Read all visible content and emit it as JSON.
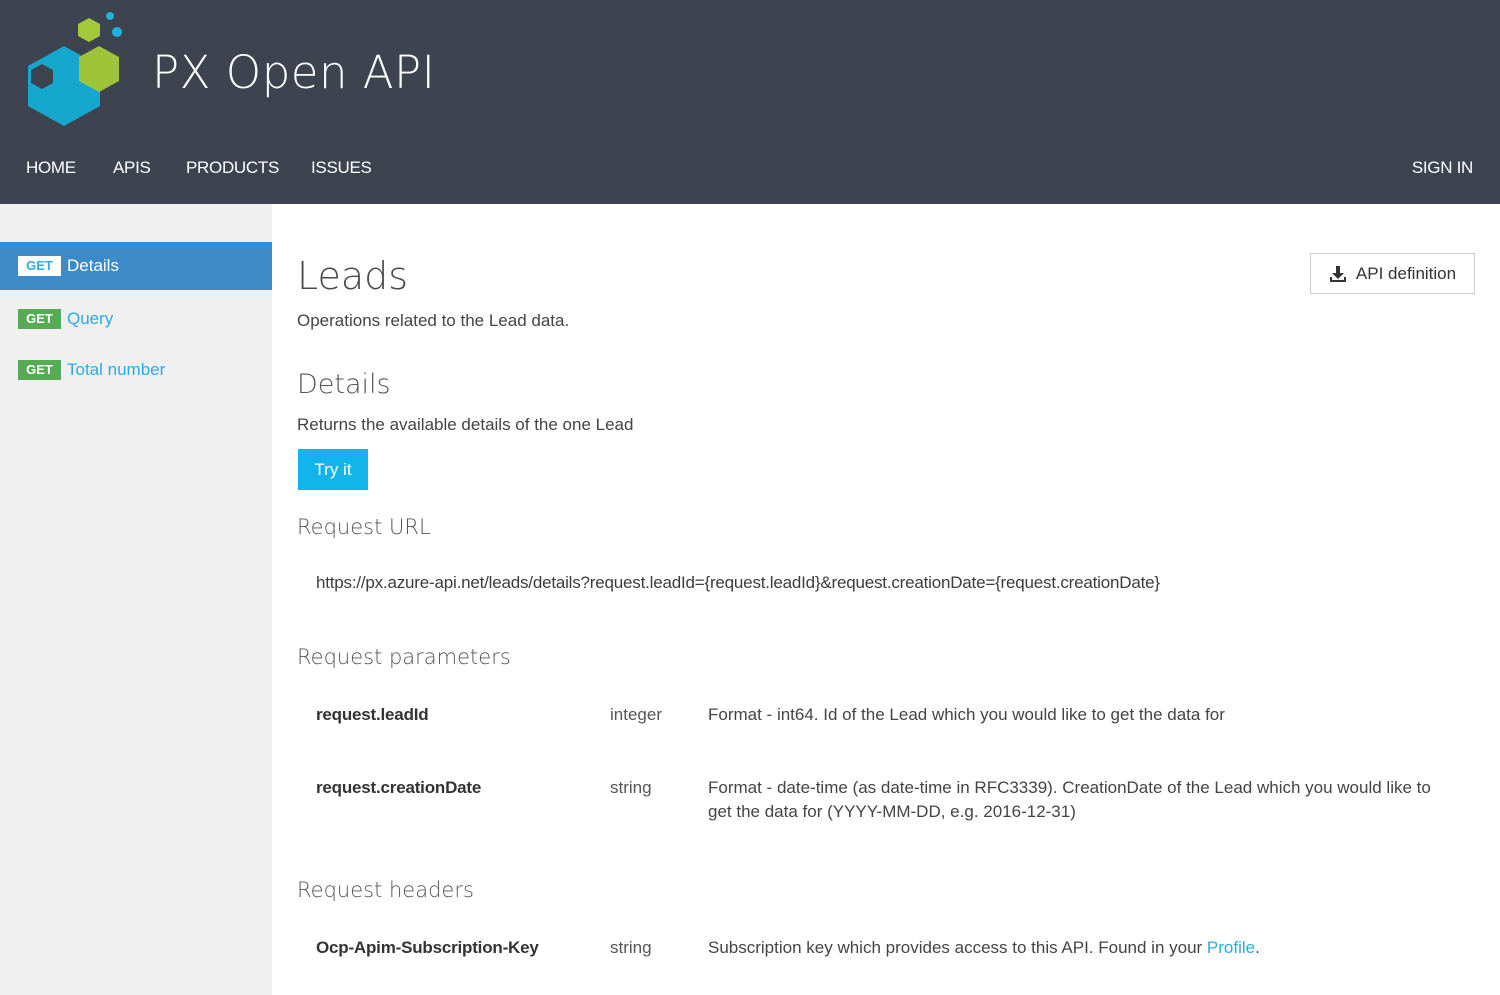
{
  "header": {
    "app_title": "PX Open API",
    "logo_icon": "hexagon-cluster-logo",
    "nav": [
      {
        "label": "HOME"
      },
      {
        "label": "APIS"
      },
      {
        "label": "PRODUCTS"
      },
      {
        "label": "ISSUES"
      }
    ],
    "sign_in": "SIGN IN"
  },
  "sidebar": {
    "items": [
      {
        "method": "GET",
        "label": "Details",
        "active": true
      },
      {
        "method": "GET",
        "label": "Query",
        "active": false
      },
      {
        "method": "GET",
        "label": "Total number",
        "active": false
      }
    ]
  },
  "main": {
    "api_definition_label": "API definition",
    "api_definition_icon": "download-icon",
    "title": "Leads",
    "description": "Operations related to the Lead data.",
    "operation": {
      "title": "Details",
      "description": "Returns the available details of the one Lead",
      "try_label": "Try it"
    },
    "request_url": {
      "heading": "Request URL",
      "url": "https://px.azure-api.net/leads/details?request.leadId={request.leadId}&request.creationDate={request.creationDate}"
    },
    "request_parameters": {
      "heading": "Request parameters",
      "rows": [
        {
          "name": "request.leadId",
          "type": "integer",
          "description": "Format - int64. Id of the Lead which you would like to get the data for"
        },
        {
          "name": "request.creationDate",
          "type": "string",
          "description": "Format - date-time (as date-time in RFC3339). CreationDate of the Lead which you would like to get the data for (YYYY-MM-DD, e.g. 2016-12-31)"
        }
      ]
    },
    "request_headers": {
      "heading": "Request headers",
      "rows": [
        {
          "name": "Ocp-Apim-Subscription-Key",
          "type": "string",
          "description_prefix": "Subscription key which provides access to this API. Found in your ",
          "link_text": "Profile",
          "description_suffix": "."
        }
      ]
    }
  },
  "colors": {
    "header_bg": "#3d4450",
    "sidebar_bg": "#f0f0f0",
    "active_item": "#3d8ac9",
    "get_badge": "#56ac55",
    "link": "#2aabe2",
    "try_button": "#12b4ec"
  }
}
